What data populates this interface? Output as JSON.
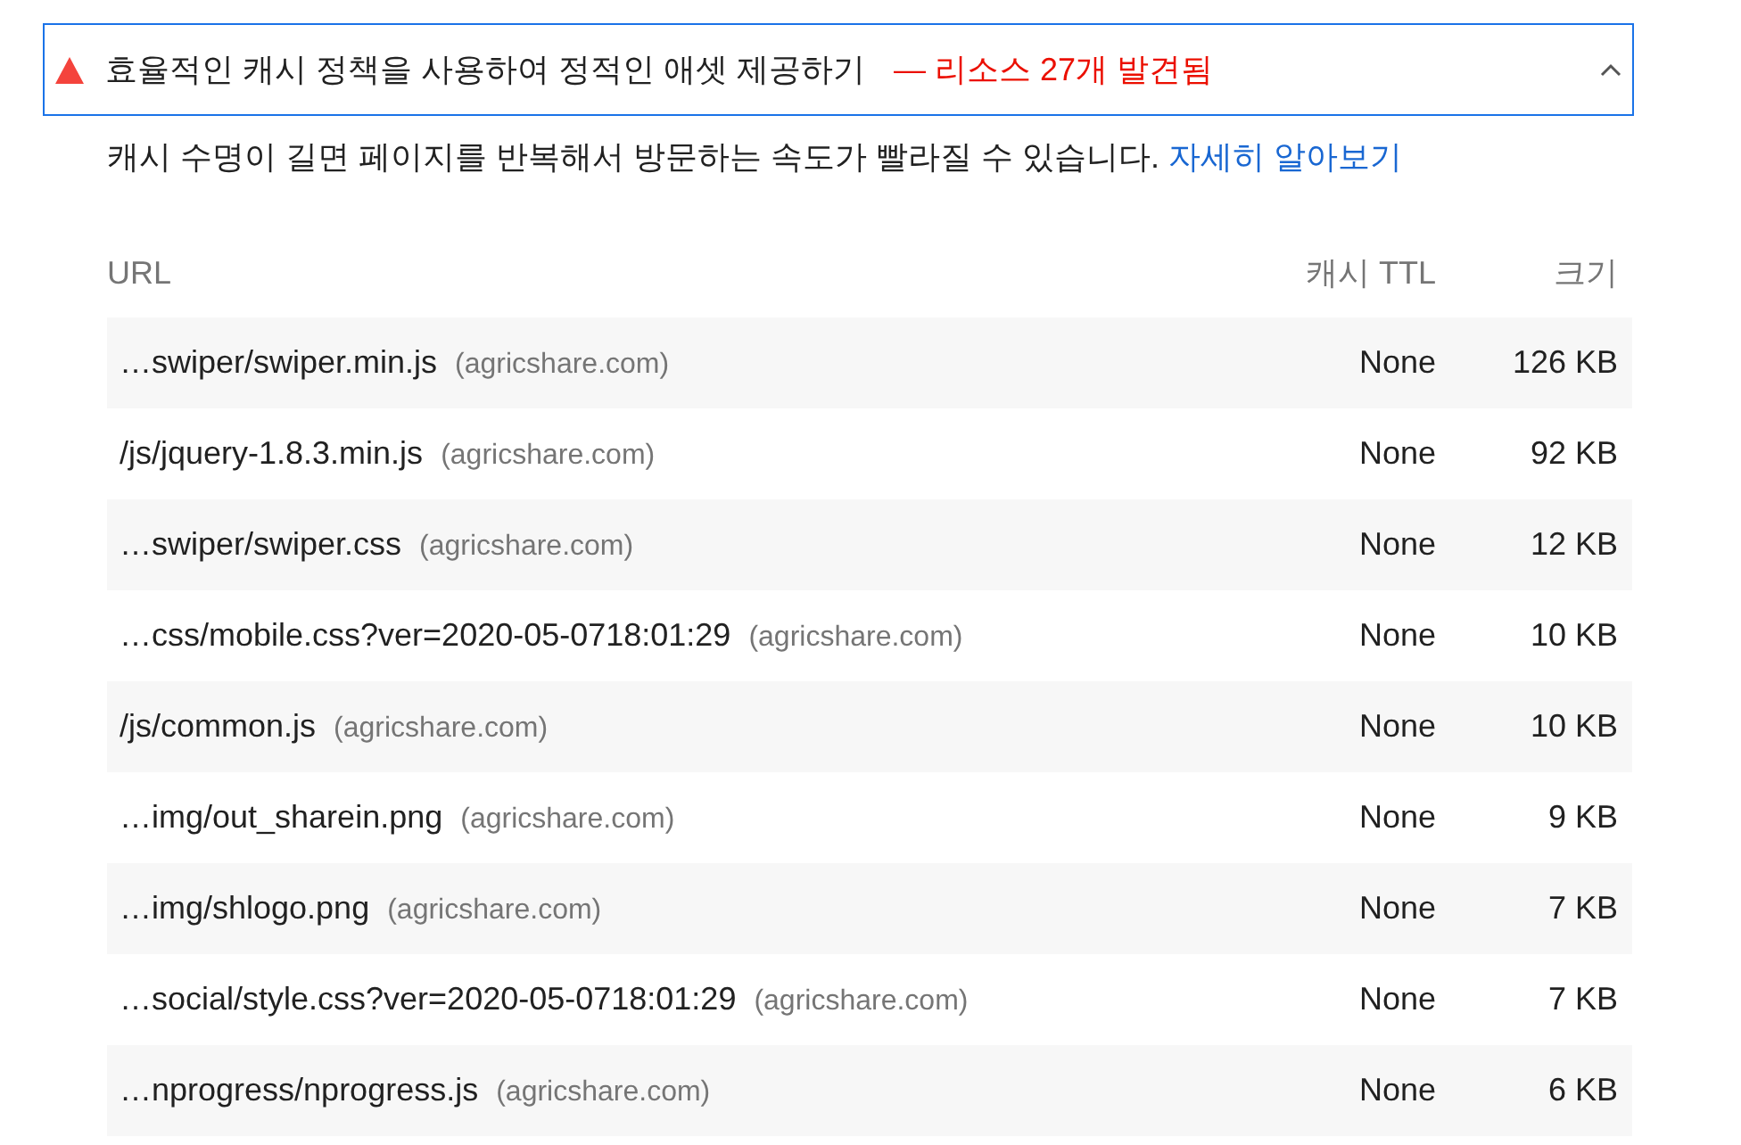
{
  "audit": {
    "title": "효율적인 캐시 정책을 사용하여 정적인 애셋 제공하기",
    "display_value": "— 리소스 27개 발견됨",
    "expanded": true,
    "description": "캐시 수명이 길면 페이지를 반복해서 방문하는 속도가 빨라질 수 있습니다.",
    "learn_more": "자세히 알아보기"
  },
  "table": {
    "columns": [
      "URL",
      "캐시 TTL",
      "크기"
    ],
    "rows": [
      {
        "url": "…swiper/swiper.min.js",
        "host": "(agricshare.com)",
        "ttl": "None",
        "size": "126 KB"
      },
      {
        "url": "/js/jquery-1.8.3.min.js",
        "host": "(agricshare.com)",
        "ttl": "None",
        "size": "92 KB"
      },
      {
        "url": "…swiper/swiper.css",
        "host": "(agricshare.com)",
        "ttl": "None",
        "size": "12 KB"
      },
      {
        "url": "…css/mobile.css?ver=2020-05-0718:01:29",
        "host": "(agricshare.com)",
        "ttl": "None",
        "size": "10 KB"
      },
      {
        "url": "/js/common.js",
        "host": "(agricshare.com)",
        "ttl": "None",
        "size": "10 KB"
      },
      {
        "url": "…img/out_sharein.png",
        "host": "(agricshare.com)",
        "ttl": "None",
        "size": "9 KB"
      },
      {
        "url": "…img/shlogo.png",
        "host": "(agricshare.com)",
        "ttl": "None",
        "size": "7 KB"
      },
      {
        "url": "…social/style.css?ver=2020-05-0718:01:29",
        "host": "(agricshare.com)",
        "ttl": "None",
        "size": "7 KB"
      },
      {
        "url": "…nprogress/nprogress.js",
        "host": "(agricshare.com)",
        "ttl": "None",
        "size": "6 KB"
      }
    ]
  }
}
